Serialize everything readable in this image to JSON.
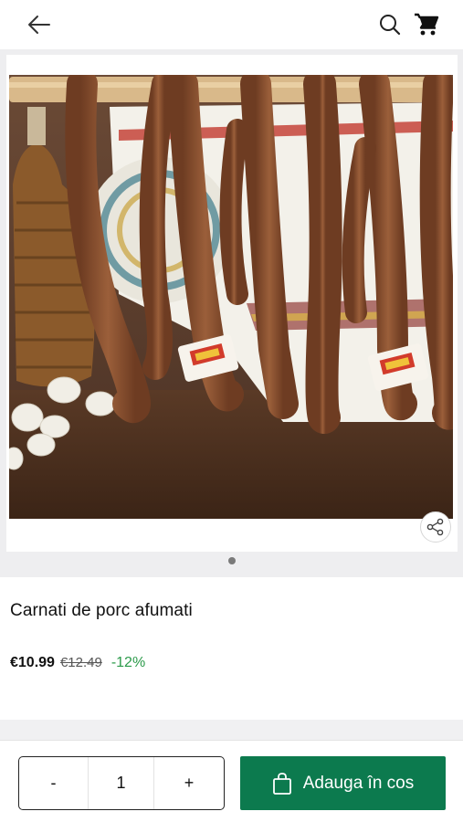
{
  "header": {
    "back_icon": "arrow-left-icon",
    "search_icon": "search-icon",
    "cart_icon": "cart-icon"
  },
  "gallery": {
    "image_alt": "Carnati de porc afumati",
    "slide_count": 1,
    "active_slide": 1,
    "share_icon": "share-icon"
  },
  "product": {
    "title": "Carnati de porc afumati",
    "price": "€10.99",
    "old_price": "€12.49",
    "discount": "-12%"
  },
  "cart_bar": {
    "minus_label": "-",
    "quantity": "1",
    "plus_label": "+",
    "add_label": "Adauga în cos",
    "bag_icon": "shopping-bag-icon"
  },
  "colors": {
    "accent_green": "#0c7a4e",
    "discount_green": "#2b9a4a"
  }
}
